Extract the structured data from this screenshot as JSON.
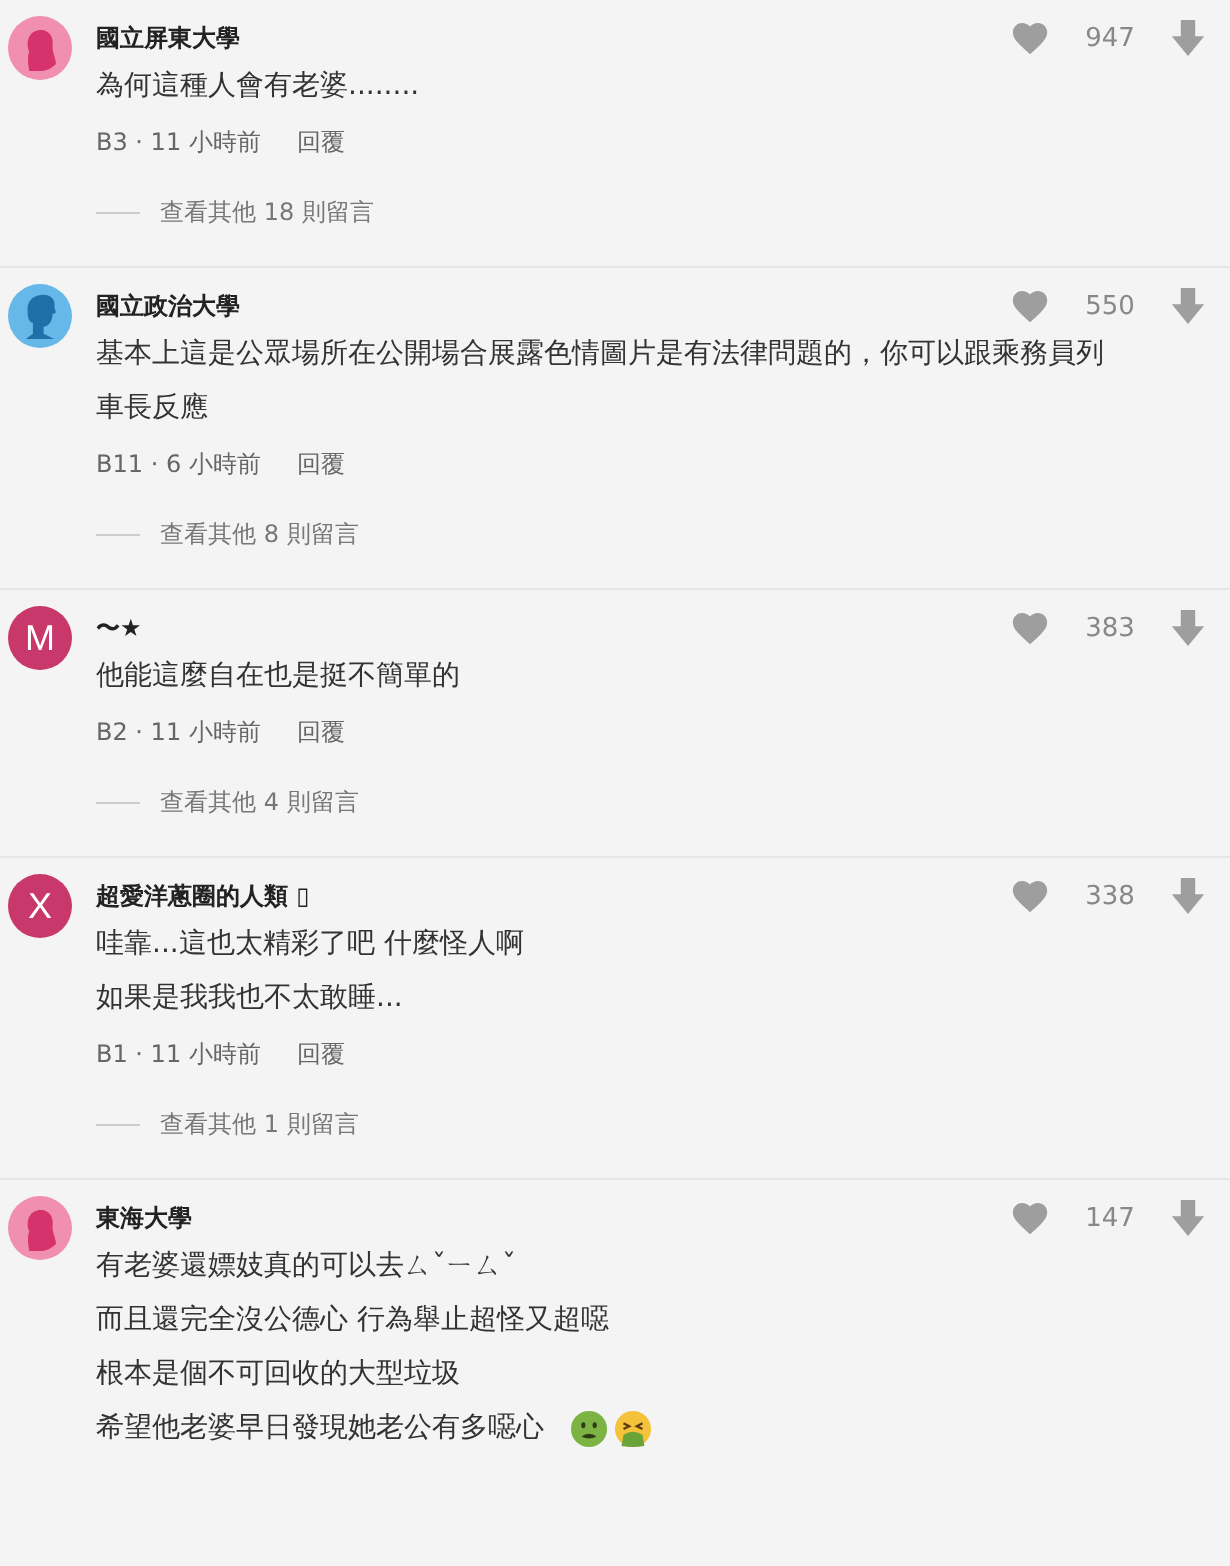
{
  "comments": [
    {
      "avatar": {
        "kind": "female"
      },
      "name": "國立屏東大學",
      "lines": [
        "為何這種人會有老婆........"
      ],
      "info": "B3 · 11 小時前",
      "reply": "回覆",
      "likes": "947",
      "more_replies": "查看其他 18 則留言"
    },
    {
      "avatar": {
        "kind": "male"
      },
      "name": "國立政治大學",
      "lines": [
        "基本上這是公眾場所在公開場合展露色情圖片是有法律問題的，你可以跟乘務員列車長反應"
      ],
      "info": "B11 · 6 小時前",
      "reply": "回覆",
      "likes": "550",
      "more_replies": "查看其他 8 則留言"
    },
    {
      "avatar": {
        "kind": "letter",
        "letter": "M"
      },
      "name": "〜★",
      "lines": [
        "他能這麼自在也是挺不簡單的"
      ],
      "info": "B2 · 11 小時前",
      "reply": "回覆",
      "likes": "383",
      "more_replies": "查看其他 4 則留言"
    },
    {
      "avatar": {
        "kind": "letter",
        "letter": "X"
      },
      "name": "超愛洋蔥圈的人類 ▯",
      "lines": [
        "哇靠...這也太精彩了吧 什麼怪人啊",
        "如果是我我也不太敢睡..."
      ],
      "info": "B1 · 11 小時前",
      "reply": "回覆",
      "likes": "338",
      "more_replies": "查看其他 1 則留言"
    },
    {
      "avatar": {
        "kind": "female"
      },
      "name": "東海大學",
      "lines": [
        "有老婆還嫖妓真的可以去ㄙˇㄧㄙˇ",
        "而且還完全沒公德心 行為舉止超怪又超噁",
        "根本是個不可回收的大型垃圾",
        "希望他老婆早日發現她老公有多噁心"
      ],
      "emojis": [
        {
          "kind": "nauseated"
        },
        {
          "kind": "vomiting"
        }
      ],
      "likes": "147"
    }
  ]
}
